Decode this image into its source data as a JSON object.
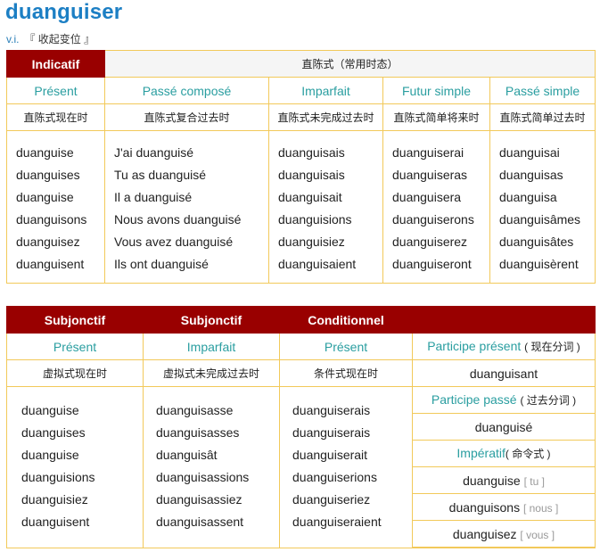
{
  "header": {
    "word": "duanguiser",
    "pos": "v.i.",
    "gloss": "『 收起变位 』"
  },
  "indicatif_table": {
    "mood_label": "Indicatif",
    "mood_desc": "直陈式（常用时态）",
    "columns": [
      {
        "tense": "Présent",
        "cn": "直陈式现在时",
        "forms": [
          "duanguise",
          "duanguises",
          "duanguise",
          "duanguisons",
          "duanguisez",
          "duanguisent"
        ]
      },
      {
        "tense": "Passé composé",
        "cn": "直陈式复合过去时",
        "forms": [
          "J'ai duanguisé",
          "Tu as duanguisé",
          "Il a duanguisé",
          "Nous avons duanguisé",
          "Vous avez duanguisé",
          "Ils ont duanguisé"
        ]
      },
      {
        "tense": "Imparfait",
        "cn": "直陈式未完成过去时",
        "forms": [
          "duanguisais",
          "duanguisais",
          "duanguisait",
          "duanguisions",
          "duanguisiez",
          "duanguisaient"
        ]
      },
      {
        "tense": "Futur simple",
        "cn": "直陈式简单将来时",
        "forms": [
          "duanguiserai",
          "duanguiseras",
          "duanguisera",
          "duanguiserons",
          "duanguiserez",
          "duanguiseront"
        ]
      },
      {
        "tense": "Passé simple",
        "cn": "直陈式简单过去时",
        "forms": [
          "duanguisai",
          "duanguisas",
          "duanguisa",
          "duanguisâmes",
          "duanguisâtes",
          "duanguisèrent"
        ]
      }
    ]
  },
  "second_table": {
    "columns": [
      {
        "mood": "Subjonctif",
        "tense": "Présent",
        "cn": "虚拟式现在时",
        "forms": [
          "duanguise",
          "duanguises",
          "duanguise",
          "duanguisions",
          "duanguisiez",
          "duanguisent"
        ]
      },
      {
        "mood": "Subjonctif",
        "tense": "Imparfait",
        "cn": "虚拟式未完成过去时",
        "forms": [
          "duanguisasse",
          "duanguisasses",
          "duanguisât",
          "duanguisassions",
          "duanguisassiez",
          "duanguisassent"
        ]
      },
      {
        "mood": "Conditionnel",
        "tense": "Présent",
        "cn": "条件式现在时",
        "forms": [
          "duanguiserais",
          "duanguiserais",
          "duanguiserait",
          "duanguiserions",
          "duanguiseriez",
          "duanguiseraient"
        ]
      }
    ],
    "nonfinite": {
      "participe_present_label": "Participe présent",
      "participe_present_cn": "( 现在分词 )",
      "participe_present_form": "duanguisant",
      "participe_passe_label": "Participe passé",
      "participe_passe_cn": "( 过去分词 )",
      "participe_passe_form": "duanguisé",
      "imperatif_label": "Impératif",
      "imperatif_cn": "( 命令式 )",
      "imperatif_forms": [
        {
          "form": "duanguise",
          "person": "[ tu ]"
        },
        {
          "form": "duanguisons",
          "person": "[ nous ]"
        },
        {
          "form": "duanguisez",
          "person": "[ vous ]"
        }
      ]
    }
  }
}
